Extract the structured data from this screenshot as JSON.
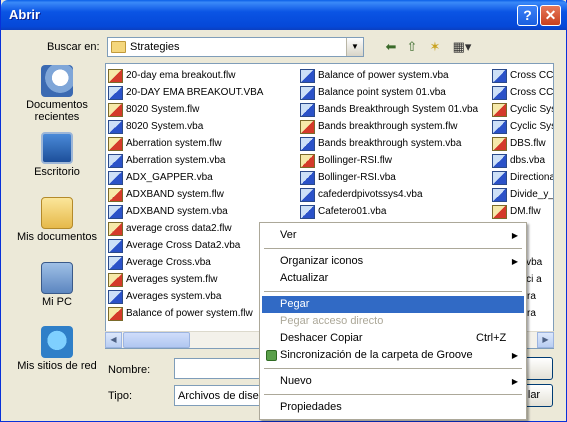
{
  "window": {
    "title": "Abrir"
  },
  "titlebar_buttons": {
    "help": "?",
    "close": "✕"
  },
  "lookin": {
    "label": "Buscar en:",
    "value": "Strategies"
  },
  "places": [
    {
      "label": "Documentos recientes",
      "icon": "recent-documents-icon"
    },
    {
      "label": "Escritorio",
      "icon": "desktop-icon"
    },
    {
      "label": "Mis documentos",
      "icon": "my-documents-icon"
    },
    {
      "label": "Mi PC",
      "icon": "my-computer-icon"
    },
    {
      "label": "Mis sitios de red",
      "icon": "network-places-icon"
    }
  ],
  "files": {
    "column1": [
      {
        "name": "20-day ema breakout.flw",
        "type": "flw"
      },
      {
        "name": "20-DAY EMA BREAKOUT.VBA",
        "type": "vba"
      },
      {
        "name": "8020 System.flw",
        "type": "flw"
      },
      {
        "name": "8020 System.vba",
        "type": "vba"
      },
      {
        "name": "Aberration system.flw",
        "type": "flw"
      },
      {
        "name": "Aberration system.vba",
        "type": "vba"
      },
      {
        "name": "ADX_GAPPER.vba",
        "type": "vba"
      },
      {
        "name": "ADXBAND system.flw",
        "type": "flw"
      },
      {
        "name": "ADXBAND system.vba",
        "type": "vba"
      },
      {
        "name": "average cross data2.flw",
        "type": "flw"
      },
      {
        "name": "Average Cross Data2.vba",
        "type": "vba"
      },
      {
        "name": "Average Cross.vba",
        "type": "vba"
      },
      {
        "name": "Averages system.flw",
        "type": "flw"
      },
      {
        "name": "Averages system.vba",
        "type": "vba"
      },
      {
        "name": "Balance of power system.flw",
        "type": "flw"
      }
    ],
    "column2": [
      {
        "name": "Balance of power system.vba",
        "type": "vba"
      },
      {
        "name": "Balance point system 01.vba",
        "type": "vba"
      },
      {
        "name": "Bands Breakthrough System 01.vba",
        "type": "vba"
      },
      {
        "name": "Bands breakthrough system.flw",
        "type": "flw"
      },
      {
        "name": "Bands breakthrough system.vba",
        "type": "vba"
      },
      {
        "name": "Bollinger-RSI.flw",
        "type": "flw"
      },
      {
        "name": "Bollinger-RSI.vba",
        "type": "vba"
      },
      {
        "name": "cafederdpivotssys4.vba",
        "type": "vba"
      },
      {
        "name": "Cafetero01.vba",
        "type": "vba"
      }
    ],
    "column3": [
      {
        "name": "Cross CCI",
        "type": "vba"
      },
      {
        "name": "Cross CCI",
        "type": "vba"
      },
      {
        "name": "Cyclic Sys",
        "type": "flw"
      },
      {
        "name": "Cyclic Sys",
        "type": "vba"
      },
      {
        "name": "DBS.flw",
        "type": "flw"
      },
      {
        "name": "dbs.vba",
        "type": "vba"
      },
      {
        "name": "Directional",
        "type": "vba"
      },
      {
        "name": "Divide_y_",
        "type": "vba"
      },
      {
        "name": "DM.flw",
        "type": "flw"
      },
      {
        "name": "vba",
        "type": "vba"
      },
      {
        "name": "flw",
        "type": "flw"
      },
      {
        "name": "XA.vba",
        "type": "vba"
      },
      {
        "name": "nacci a",
        "type": "vba"
      },
      {
        "name": "Avera",
        "type": "vba"
      },
      {
        "name": "Avera",
        "type": "vba"
      }
    ]
  },
  "filename": {
    "label": "Nombre:",
    "value": ""
  },
  "filetype": {
    "label": "Tipo:",
    "value": "Archivos de diseñ"
  },
  "buttons": {
    "cancel": "lar"
  },
  "context_menu": {
    "ver": "Ver",
    "organizar": "Organizar iconos",
    "actualizar": "Actualizar",
    "pegar": "Pegar",
    "pegar_acceso": "Pegar acceso directo",
    "deshacer": "Deshacer Copiar",
    "deshacer_shortcut": "Ctrl+Z",
    "groove": "Sincronización de la carpeta de Groove",
    "nuevo": "Nuevo",
    "propiedades": "Propiedades"
  }
}
